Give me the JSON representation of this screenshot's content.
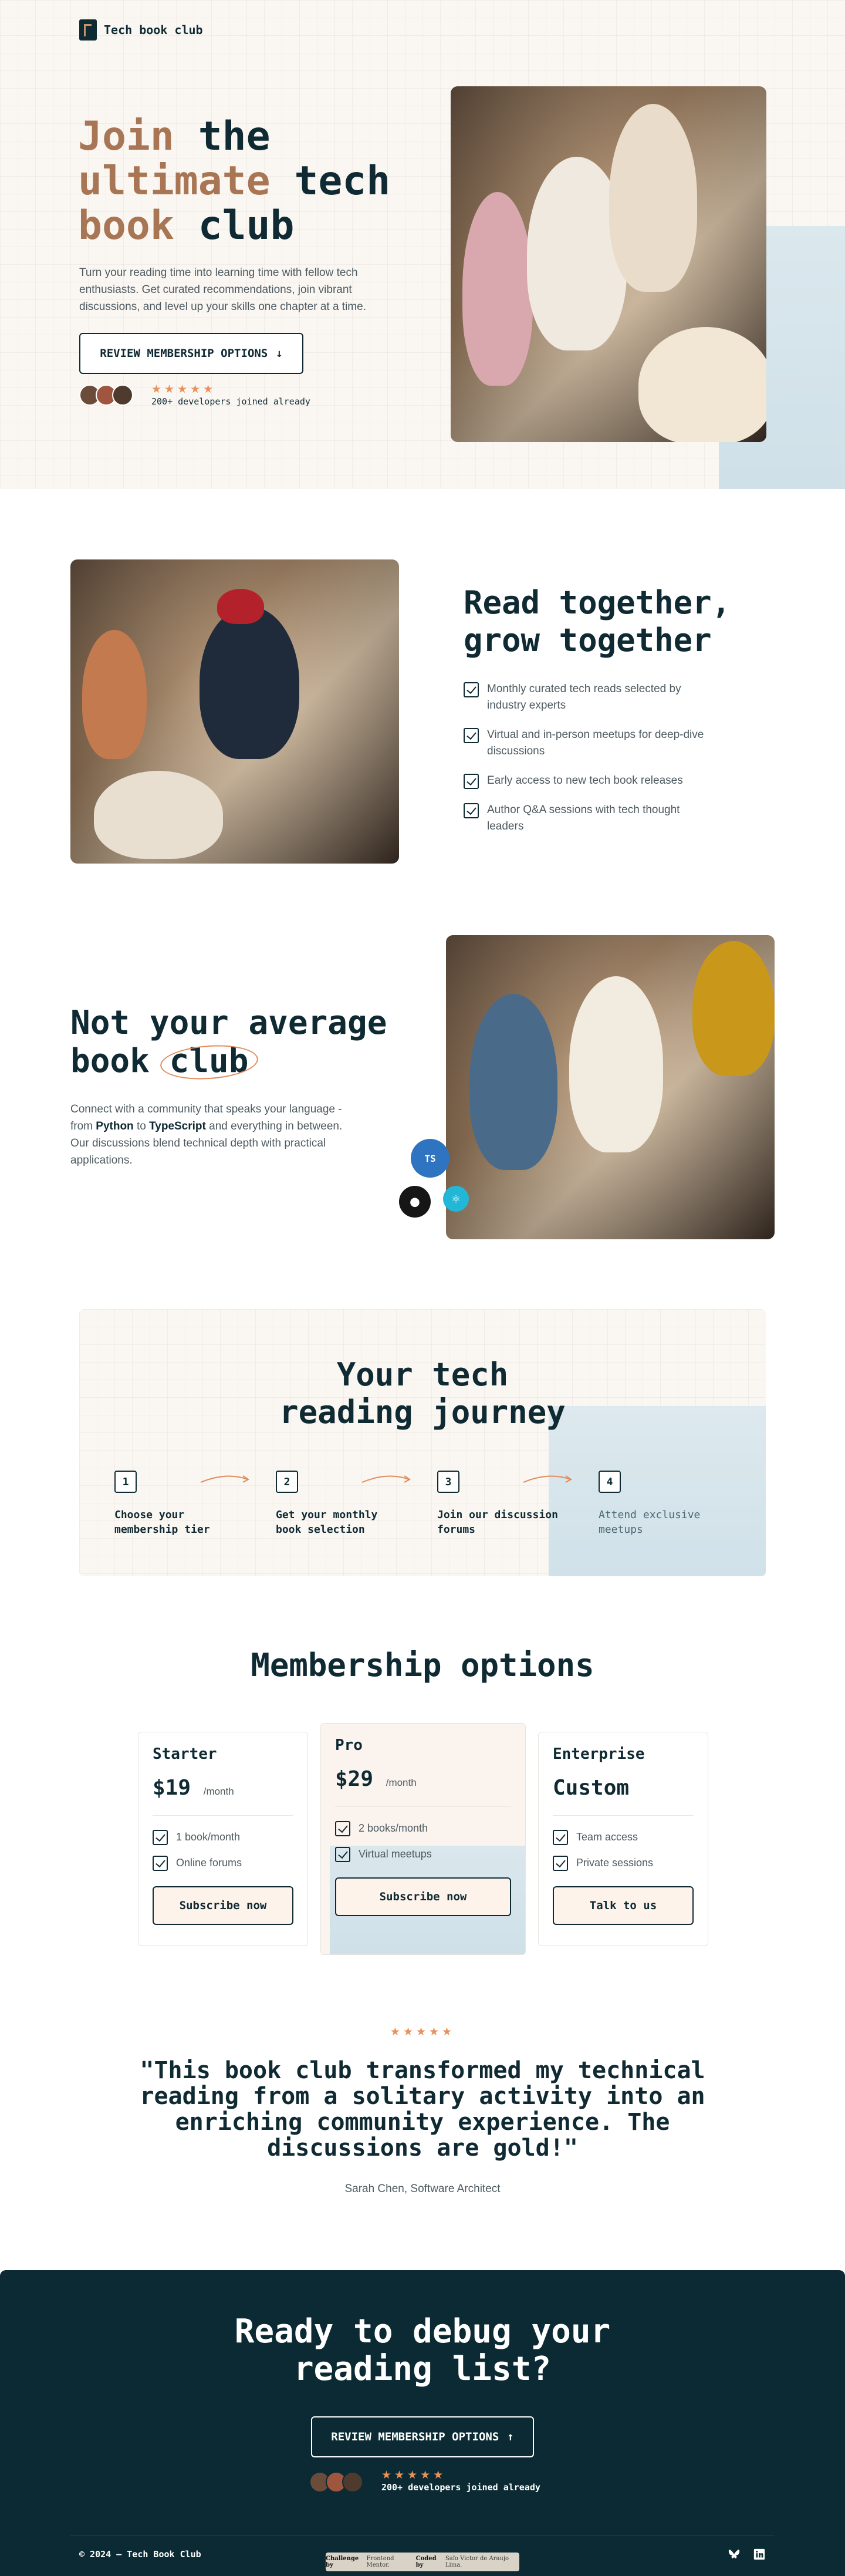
{
  "brand": {
    "name": "Tech book club"
  },
  "hero": {
    "title_accent": "Join the ultimate tech book club",
    "title_line1_a": "Join",
    "title_line1_b": "the",
    "title_line2_a": "ultimate",
    "title_line2_b": "tech",
    "title_line3_a": "book",
    "title_line3_b": "club",
    "description": "Turn your reading time into learning time with fellow tech enthusiasts. Get curated recommendations, join vibrant discussions, and level up your skills one chapter at a time.",
    "cta_label": "REVIEW MEMBERSHIP OPTIONS",
    "cta_icon": "arrow-down-icon",
    "rating": "★★★★★",
    "social_proof": "200+ developers joined already"
  },
  "read_together": {
    "title_line1": "Read together,",
    "title_line2": "grow together",
    "features": [
      "Monthly curated tech reads selected by industry experts",
      "Virtual and in-person meetups for deep-dive discussions",
      "Early access to new tech book releases",
      "Author Q&A sessions with tech thought leaders"
    ]
  },
  "not_average": {
    "title_line1": "Not your average",
    "title_line2_a": "book",
    "title_line2_b": "club",
    "desc_pre": "Connect with a community that speaks your language - from ",
    "desc_python": "Python",
    "desc_mid": " to ",
    "desc_ts": "TypeScript",
    "desc_post": " and everything in between. Our discussions blend technical depth with practical applications.",
    "badges": {
      "ts": "TS",
      "react": "react-icon",
      "github": "github-icon"
    }
  },
  "journey": {
    "title_line1": "Your tech",
    "title_line2": "reading journey",
    "steps": [
      {
        "num": "1",
        "label": "Choose your membership tier"
      },
      {
        "num": "2",
        "label": "Get your monthly book selection"
      },
      {
        "num": "3",
        "label": "Join our discussion forums"
      },
      {
        "num": "4",
        "label": "Attend exclusive meetups"
      }
    ]
  },
  "membership": {
    "title": "Membership options",
    "plans": [
      {
        "name": "Starter",
        "price": "$19",
        "period": "/month",
        "features": [
          "1 book/month",
          "Online forums"
        ],
        "button": "Subscribe now"
      },
      {
        "name": "Pro",
        "price": "$29",
        "period": "/month",
        "features": [
          "2 books/month",
          "Virtual meetups"
        ],
        "button": "Subscribe now"
      },
      {
        "name": "Enterprise",
        "price": "Custom",
        "period": "",
        "features": [
          "Team access",
          "Private sessions"
        ],
        "button": "Talk to us"
      }
    ]
  },
  "testimonial": {
    "stars": "★★★★★",
    "quote": "\"This book club transformed my technical reading from a solitary activity into an enriching community experience. The discussions are gold!\"",
    "author": "Sarah Chen, Software Architect"
  },
  "cta": {
    "title_line1": "Ready to debug your",
    "title_line2": "reading list?",
    "button": "REVIEW MEMBERSHIP OPTIONS",
    "button_icon": "arrow-up-icon",
    "stars": "★★★★★",
    "social_proof": "200+ developers joined already"
  },
  "footer": {
    "copyright": "© 2024 – Tech Book Club",
    "credit_challenge": "Challenge by",
    "credit_challenge_by": "Frontend Mentor.",
    "credit_coded": "Coded by",
    "credit_coded_by": "Saïo Victor de Araujo Lima.",
    "social_icons": [
      "bluesky-icon",
      "linkedin-icon"
    ]
  }
}
